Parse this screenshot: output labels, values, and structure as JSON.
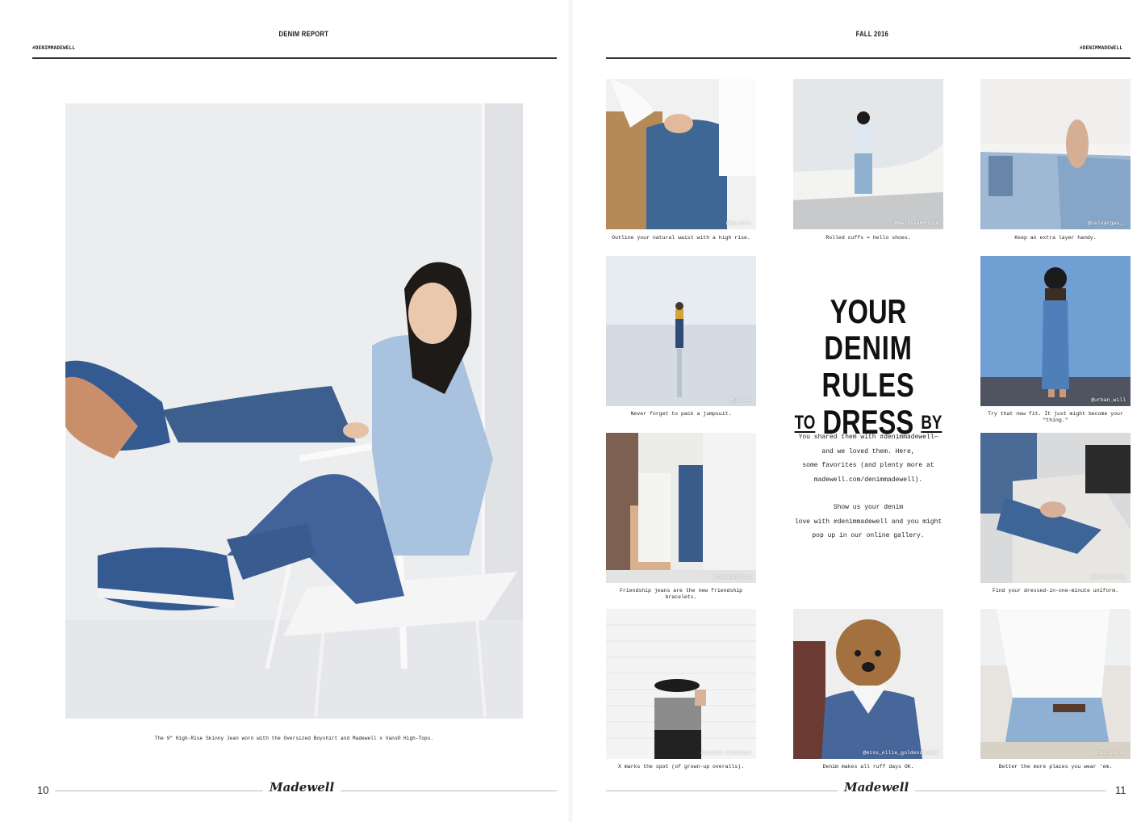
{
  "left_page": {
    "running_title": "DENIM REPORT",
    "hashtag": "#DENIMMADEWELL",
    "hero_caption": "The 9\" High-Rise Skinny Jean worn with the Oversized Boyshirt and Madewell x Vans® High-Tops.",
    "folio": "10",
    "logo": "Madewell"
  },
  "right_page": {
    "running_title": "FALL 2016",
    "hashtag": "#DENIMMADEWELL",
    "folio": "11",
    "logo": "Madewell",
    "headline": {
      "line1": "YOUR",
      "line2": "DENIM RULES",
      "to": "TO",
      "dress": "DRESS",
      "by": "BY"
    },
    "body": {
      "p1_l1": "You shared them with #denimmadewell—",
      "p1_l2": "and we loved them. Here,",
      "p1_l3": "some favorites (and plenty more at",
      "p1_l4": "madewell.com/denimmadewell).",
      "p2_l1": "Show us your denim",
      "p2_l2": "love with #denimmadewell and you might",
      "p2_l3": "pop up in our online gallery."
    },
    "tiles": [
      {
        "handle": "@emuchic",
        "caption": "Outline your natural waist with a high rise."
      },
      {
        "handle": "@melissamonica",
        "caption": "Rolled cuffs = hello shoes."
      },
      {
        "handle": "@celvargas__",
        "caption": "Keep an extra layer handy."
      },
      {
        "handle": "@jenoae",
        "caption": "Never forget to pack a jumpsuit."
      },
      {
        "handle": "@urban_will",
        "caption": "Try that new fit. It just might become your \"thing.\""
      },
      {
        "handle": "@findingpris",
        "caption": "Friendship jeans are the new friendship bracelets."
      },
      {
        "handle": "@karanelles",
        "caption": "Find your dressed-in-one-minute uniform."
      },
      {
        "handle": "@simply.bohemian",
        "caption": "X marks the spot (of grown-up overalls)."
      },
      {
        "handle": "@miss_ellie_goldendoodle",
        "caption": "Denim makes all ruff days OK."
      },
      {
        "handle": "@dailybiss",
        "caption": "Better the more places you wear 'em."
      }
    ]
  }
}
